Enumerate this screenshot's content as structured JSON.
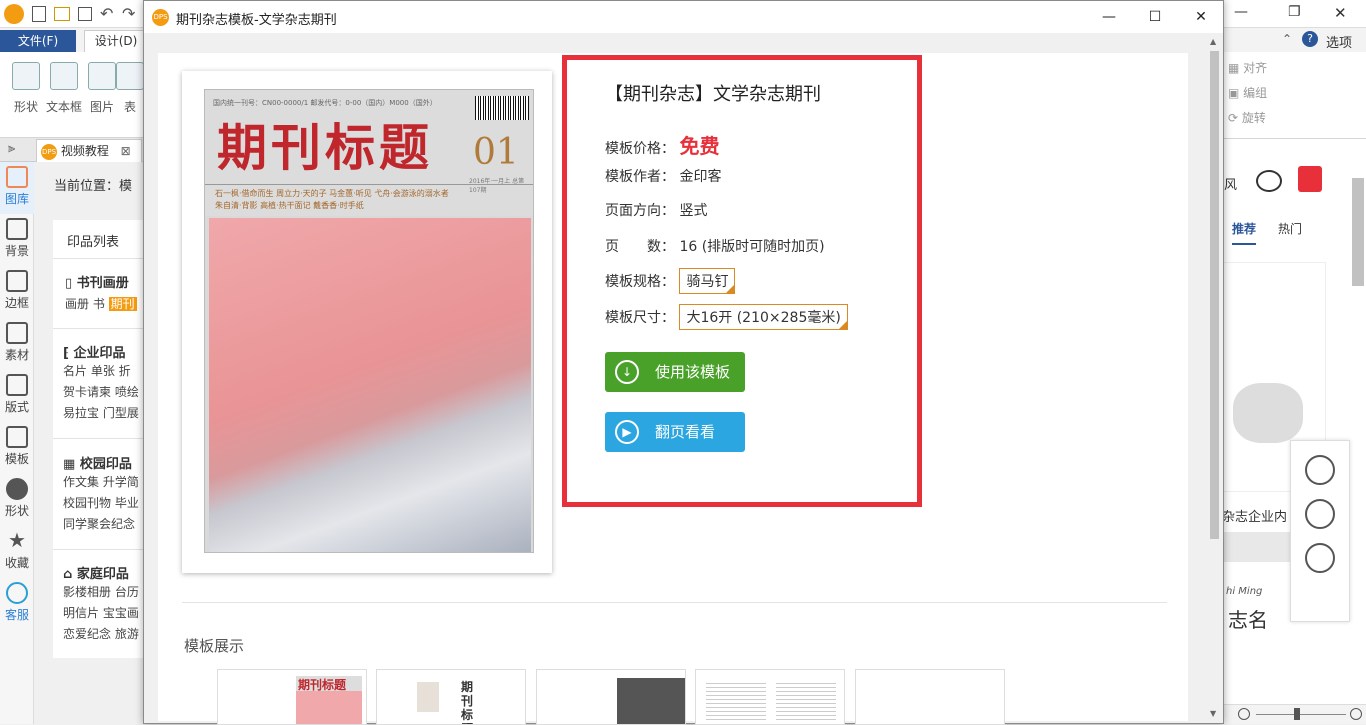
{
  "app": {
    "menu": {
      "file": "文件(F)",
      "design": "设计(D)"
    },
    "ribbon_items": [
      "形状",
      "文本框",
      "图片",
      "表"
    ],
    "doc_tab": {
      "badge": "DPS",
      "label": "视频教程",
      "close": "⊠"
    },
    "nav_items": [
      "图库",
      "背景",
      "边框",
      "素材",
      "版式",
      "模板",
      "形状",
      "收藏",
      "客服"
    ],
    "location": "当前位置：模",
    "category_panel": {
      "title": "印品列表",
      "sections": [
        {
          "title": "书刊画册",
          "links": [
            "画册  书  ",
            "期刊"
          ]
        },
        {
          "title": "企业印品",
          "links": [
            "名片  单张  折",
            "贺卡请柬  喷绘",
            "易拉宝  门型展"
          ]
        },
        {
          "title": "校园印品",
          "links": [
            "作文集  升学简",
            "校园刊物  毕业",
            "同学聚会纪念"
          ]
        },
        {
          "title": "家庭印品",
          "links": [
            "影楼相册  台历",
            "明信片  宝宝画",
            "恋爱纪念  旅游"
          ]
        }
      ]
    },
    "right_panel": {
      "options": "选项",
      "ribbon_cmds": [
        "对齐",
        "编组",
        "旋转"
      ],
      "feng": "风",
      "tabs": [
        "推荐",
        "热门"
      ],
      "caption": "杂志企业内",
      "name_text": "志名",
      "name_script": "hi Ming"
    }
  },
  "dialog": {
    "logo": "DPS",
    "title": "期刊杂志模板-文学杂志期刊",
    "controls": {
      "minimize": "—",
      "maximize": "☐",
      "close": "✕"
    },
    "cover": {
      "title": "期刊标题",
      "issue": "01",
      "header_text": "国内统一刊号：CN00-0000/1    邮发代号：0-00（国内）M000（国外）",
      "lines": [
        "石一枫·借命而生   周立力·天的子   马金蕙·听见   弋舟·会游泳的溺水者",
        "朱自清·背影   高植·热干面记   戴香香·时手纸"
      ],
      "footer": "2016年·一月上 总第107期"
    },
    "info": {
      "heading": "【期刊杂志】文学杂志期刊",
      "price_label": "模板价格：",
      "price_value": "免费",
      "author_label": "模板作者：",
      "author_value": "金印客",
      "orientation_label": "页面方向：",
      "orientation_value": "竖式",
      "pages_label": "页　　数：",
      "pages_value": "16 (排版时可随时加页)",
      "spec_label": "模板规格：",
      "spec_value": "骑马钉",
      "size_label": "模板尺寸：",
      "size_value": "大16开 (210×285毫米)",
      "use_button": "使用该模板",
      "flip_button": "翻页看看"
    },
    "showcase_title": "模板展示",
    "thumb_title": "期刊标题"
  },
  "colors": {
    "accent_red": "#e8303a",
    "use_green": "#4aa12a",
    "flip_blue": "#2ba6e1",
    "free_red": "#e8303a"
  },
  "icons": [
    "download-icon",
    "play-icon",
    "close-icon",
    "maximize-icon",
    "minimize-icon"
  ]
}
